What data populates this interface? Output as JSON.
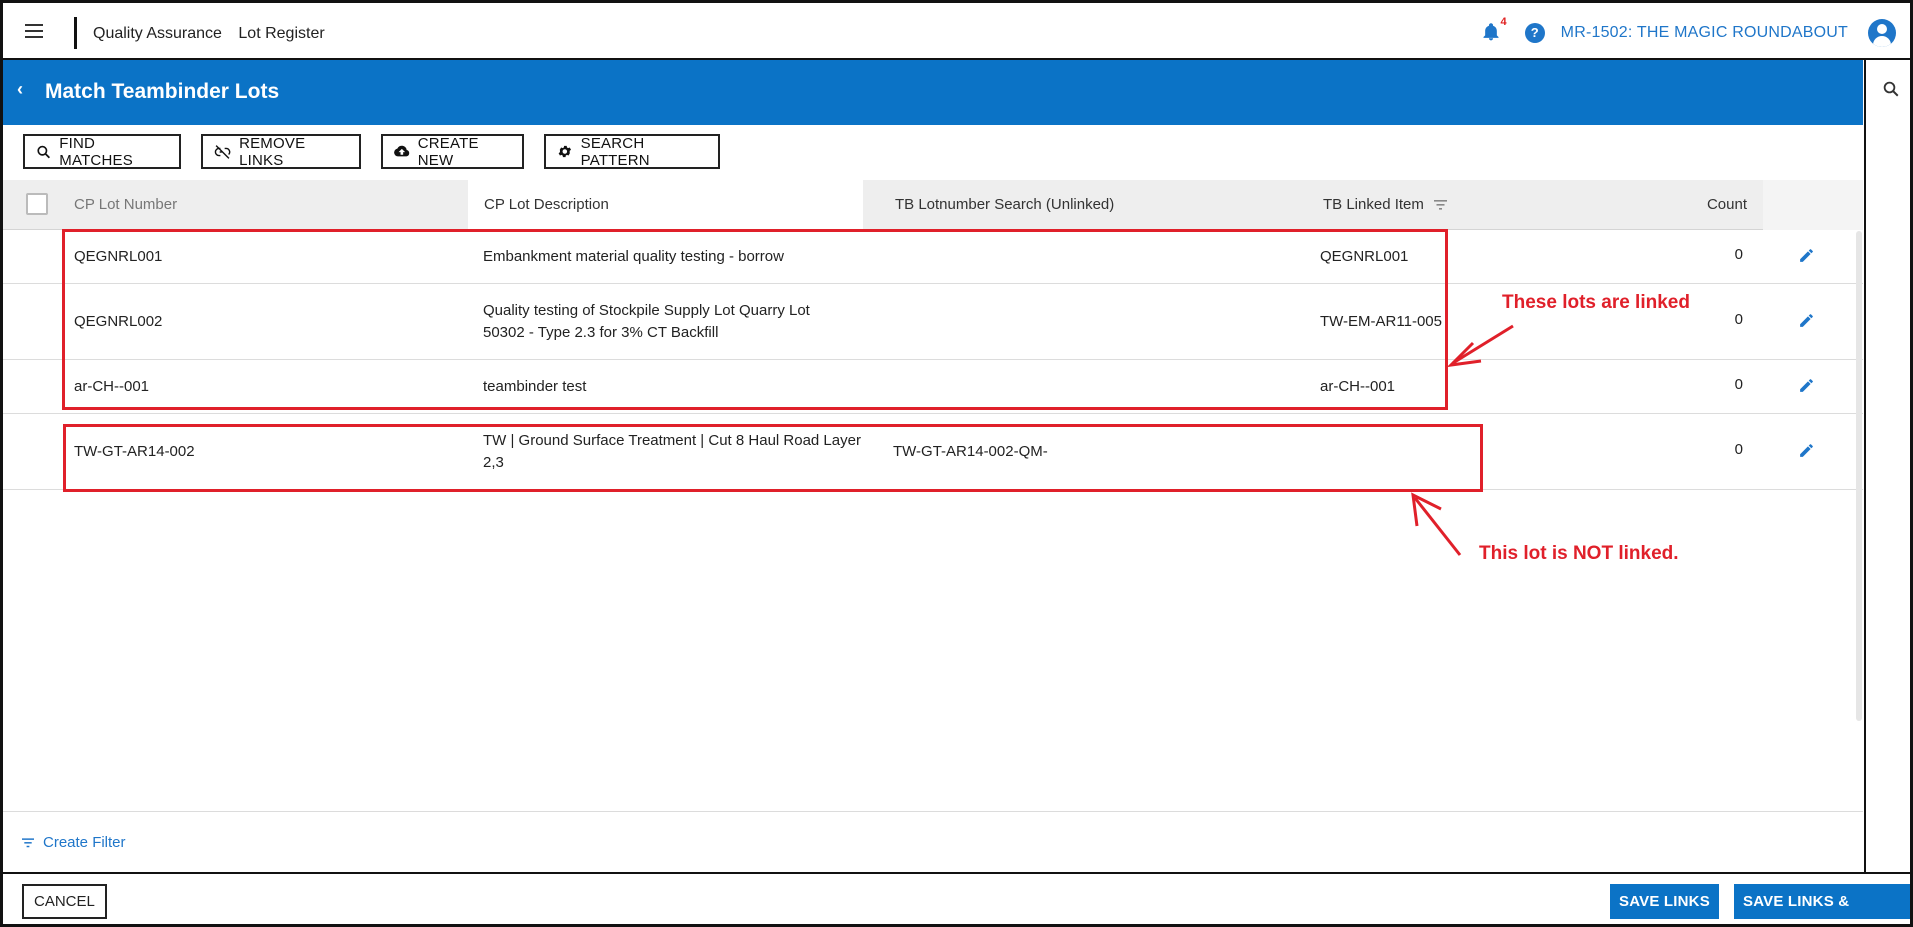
{
  "header": {
    "breadcrumbs": [
      "Quality Assurance",
      "Lot Register"
    ],
    "notification_count": "4",
    "help_symbol": "?",
    "project": "MR-1502: THE MAGIC ROUNDABOUT"
  },
  "title": {
    "back_symbol": "‹",
    "text": "Match Teambinder Lots"
  },
  "toolbar": {
    "find_matches": "FIND MATCHES",
    "remove_links": "REMOVE LINKS",
    "create_new": "CREATE NEW",
    "search_pattern": "SEARCH PATTERN"
  },
  "table": {
    "columns": {
      "cp_lot_number": "CP Lot Number",
      "cp_lot_description": "CP Lot Description",
      "tb_lotnumber_search": "TB Lotnumber Search (Unlinked)",
      "tb_linked_item": "TB Linked Item",
      "count": "Count"
    },
    "rows": [
      {
        "cp_lot_number": "QEGNRL001",
        "desc_line1": "Embankment material quality testing - borrow",
        "desc_line2": "",
        "tb_search": "",
        "tb_linked": "QEGNRL001",
        "count": "0"
      },
      {
        "cp_lot_number": "QEGNRL002",
        "desc_line1": "Quality testing of Stockpile Supply Lot Quarry Lot",
        "desc_line2": "50302 - Type 2.3 for 3% CT Backfill",
        "tb_search": "",
        "tb_linked": "TW-EM-AR11-005",
        "count": "0"
      },
      {
        "cp_lot_number": "ar-CH--001",
        "desc_line1": "teambinder test",
        "desc_line2": "",
        "tb_search": "",
        "tb_linked": "ar-CH--001",
        "count": "0"
      },
      {
        "cp_lot_number": "TW-GT-AR14-002",
        "desc_line1": "TW | Ground Surface Treatment | Cut 8 Haul Road Layer",
        "desc_line2": "2,3",
        "tb_search": "TW-GT-AR14-002-QM-",
        "tb_linked": "",
        "count": "0"
      }
    ]
  },
  "filter": {
    "create_filter": "Create Filter"
  },
  "footer": {
    "cancel": "CANCEL",
    "save_links": "SAVE LINKS",
    "save_links_close": "SAVE LINKS & CLOSE"
  },
  "annotations": {
    "linked": "These lots are linked",
    "not_linked": "This lot is NOT linked."
  },
  "colors": {
    "primary": "#0b73c6",
    "link": "#1f76c9",
    "annotation": "#e0202a"
  },
  "icons": [
    "menu-icon",
    "bell-icon",
    "help-icon",
    "avatar-icon",
    "chevron-left-icon",
    "search-icon",
    "link-off-icon",
    "cloud-upload-icon",
    "gear-icon",
    "filter-icon",
    "pencil-icon"
  ]
}
